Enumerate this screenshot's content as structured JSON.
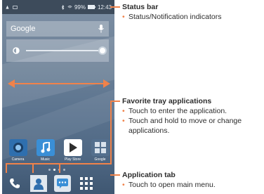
{
  "status_bar": {
    "battery": "99%",
    "time": "12:43"
  },
  "home": {
    "search_label": "Google"
  },
  "tray_apps": [
    {
      "label": "Camera",
      "icon": "camera-icon",
      "color": "#2f6fae"
    },
    {
      "label": "Music",
      "icon": "music-icon",
      "color": "#3a8fd6"
    },
    {
      "label": "Play Store",
      "icon": "play-store-icon",
      "color": "#ffffff"
    },
    {
      "label": "Google",
      "icon": "google-folder-icon",
      "color": "#54708e"
    }
  ],
  "annotations": {
    "status": {
      "title": "Status bar",
      "bullets": [
        "Status/Notification indicators"
      ]
    },
    "tray": {
      "title": "Favorite tray applications",
      "bullets": [
        "Touch to enter the application.",
        "Touch and hold to move or change applications."
      ]
    },
    "tab": {
      "title": "Application tab",
      "bullets": [
        "Touch to open main menu."
      ]
    }
  },
  "accent_color": "#f0824a"
}
